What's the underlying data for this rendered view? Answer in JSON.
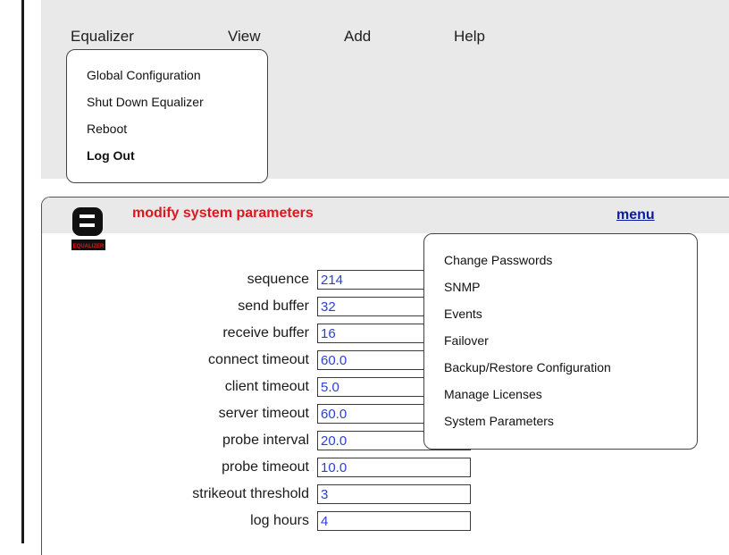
{
  "menubar": {
    "items": [
      "Equalizer",
      "View",
      "Add",
      "Help"
    ]
  },
  "equalizer_menu": {
    "items": [
      "Global Configuration",
      "Shut Down Equalizer",
      "Reboot",
      "Log Out"
    ]
  },
  "panel": {
    "title": "modify system parameters",
    "menu_link": "menu",
    "logo_text": "EQUALIZER"
  },
  "side_menu": {
    "items": [
      "Change Passwords",
      "SNMP",
      "Events",
      "Failover",
      "Backup/Restore Configuration",
      "Manage Licenses",
      "System Parameters"
    ]
  },
  "params": [
    {
      "label": "sequence",
      "value": "214"
    },
    {
      "label": "send buffer",
      "value": "32"
    },
    {
      "label": "receive buffer",
      "value": "16"
    },
    {
      "label": "connect timeout",
      "value": "60.0"
    },
    {
      "label": "client timeout",
      "value": "5.0"
    },
    {
      "label": "server timeout",
      "value": "60.0"
    },
    {
      "label": "probe interval",
      "value": "20.0"
    },
    {
      "label": "probe timeout",
      "value": "10.0"
    },
    {
      "label": "strikeout threshold",
      "value": "3"
    },
    {
      "label": "log hours",
      "value": "4"
    }
  ],
  "colors": {
    "title_red": "#e0161f",
    "link_blue": "#0b1aa0",
    "value_blue": "#2b3fd0",
    "panel_gray": "#e9e9e9"
  }
}
